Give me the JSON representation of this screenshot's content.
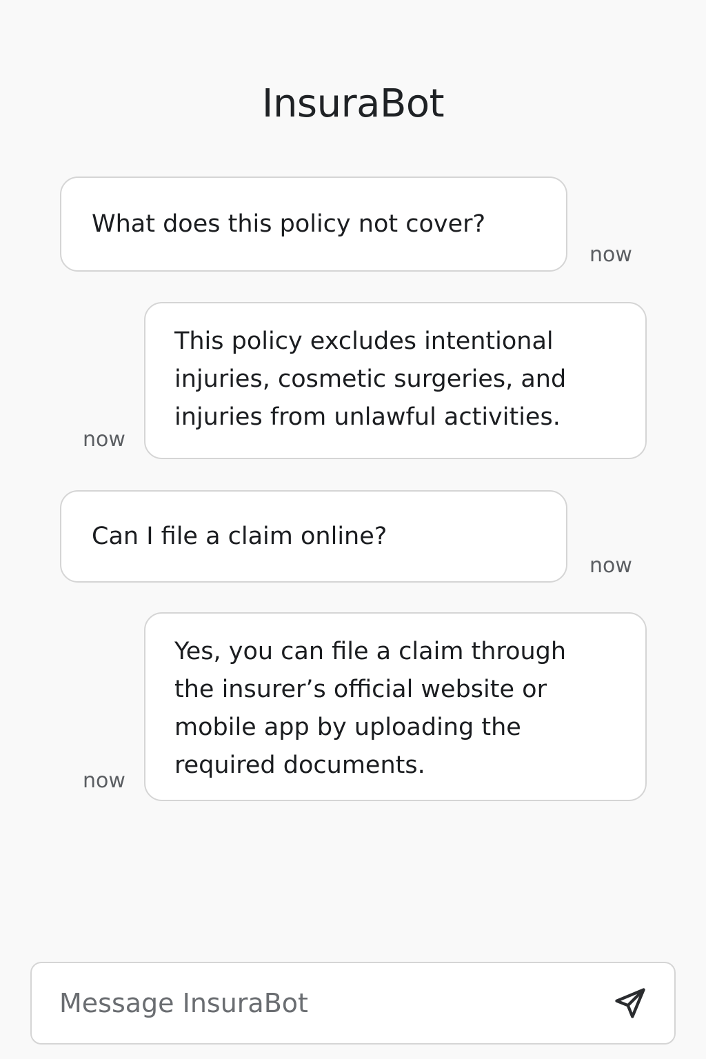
{
  "app": {
    "title": "InsuraBot"
  },
  "messages": [
    {
      "sender": "user",
      "text": "What does this policy not cover?",
      "timestamp": "now"
    },
    {
      "sender": "bot",
      "text": "This policy excludes intentional\ninjuries, cosmetic surgeries, and\ninjuries from unlawful activities.",
      "timestamp": "now"
    },
    {
      "sender": "user",
      "text": "Can I file a claim online?",
      "timestamp": "now"
    },
    {
      "sender": "bot",
      "text": "Yes, you can file a claim through\nthe insurer’s official website or\nmobile app by uploading the\nrequired documents.",
      "timestamp": "now"
    }
  ],
  "composer": {
    "placeholder": "Message InsuraBot",
    "value": "",
    "send_icon": "send-paper-plane-icon"
  },
  "colors": {
    "background": "#f9f9f9",
    "bubble": "#ffffff",
    "border": "#d5d5d5",
    "text": "#1b1d20",
    "muted": "#5b5e62"
  }
}
